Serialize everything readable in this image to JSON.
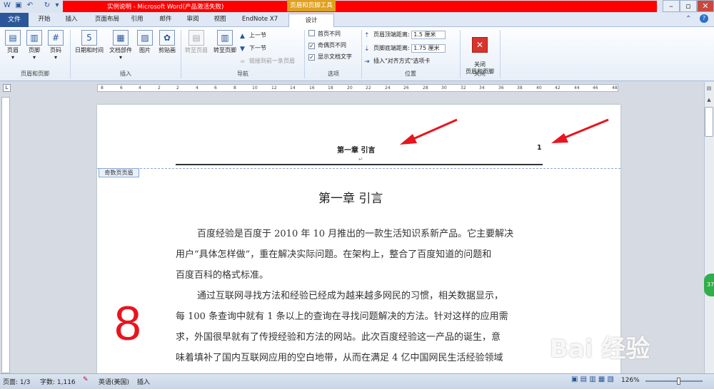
{
  "window": {
    "title": "实例说明 - Microsoft Word(产品激活失败)",
    "contextual_group": "页眉和页脚工具"
  },
  "tabs": [
    "文件",
    "开始",
    "插入",
    "页面布局",
    "引用",
    "邮件",
    "审阅",
    "视图",
    "EndNote X7",
    "设计"
  ],
  "ribbon": {
    "insert_hf_group": {
      "label": "页眉和页脚",
      "header": "页眉",
      "footer": "页脚",
      "page_number": "页码"
    },
    "insert_group": {
      "label": "插入",
      "datetime": "日期和时间",
      "docparts": "文档部件",
      "picture": "图片",
      "clipart": "剪贴画"
    },
    "nav_group": {
      "label": "导航",
      "goto_header": "转至页眉",
      "goto_footer": "转至页脚",
      "prev": "上一节",
      "next": "下一节",
      "link_prev": "链接到前一条页眉"
    },
    "options_group": {
      "label": "选项",
      "diff_first": "首页不同",
      "diff_odd_even": "奇偶页不同",
      "show_text": "显示文档文字"
    },
    "position_group": {
      "label": "位置",
      "header_top_label": "页眉顶端距离:",
      "header_top_value": "1.5 厘米",
      "footer_bottom_label": "页脚底端距离:",
      "footer_bottom_value": "1.75 厘米",
      "align_tab": "插入\"对齐方式\"选项卡"
    },
    "close_group": {
      "label": "关闭",
      "close_btn": "关闭\n页眉和页脚"
    }
  },
  "ruler_ticks": [
    "8",
    "6",
    "4",
    "2",
    "2",
    "4",
    "6",
    "8",
    "10",
    "12",
    "14",
    "16",
    "18",
    "20",
    "22",
    "24",
    "26",
    "28",
    "30",
    "32",
    "34",
    "36",
    "38",
    "40",
    "42",
    "44",
    "46",
    "48"
  ],
  "document": {
    "header_title": "第一章  引言",
    "header_page_num": "1",
    "header_label": "奇数页页眉",
    "chapter_heading": "第一章  引言",
    "paragraphs": [
      "百度经验是百度于 2010 年 10 月推出的一款生活知识系新产品。它主要解决",
      "用户“具体怎样做”，重在解决实际问题。在架构上，整合了百度知道的问题和",
      "百度百科的格式标准。",
      "通过互联网寻找方法和经验已经成为越来越多网民的习惯，相关数据显示，",
      "每 100 条查询中就有 1 条以上的查询在寻找问题解决的方法。针对这样的应用需",
      "求，外国很早就有了传授经验和方法的网站。此次百度经验这一产品的诞生，意",
      "味着填补了国内互联网应用的空白地带，从而在满足 4 亿中国网民生活经验领域"
    ],
    "annotation_number": "8"
  },
  "badge": "37",
  "watermark": "Bai 经验",
  "status": {
    "page": "页面: 1/3",
    "words": "字数: 1,116",
    "language": "英语(美国)",
    "mode": "插入",
    "zoom": "126%"
  },
  "colors": {
    "file_tab": "#2b579a",
    "title_red": "#ff0000",
    "contextual": "#e0a020",
    "annotation": "#e8141e",
    "badge": "#2fae4a"
  }
}
